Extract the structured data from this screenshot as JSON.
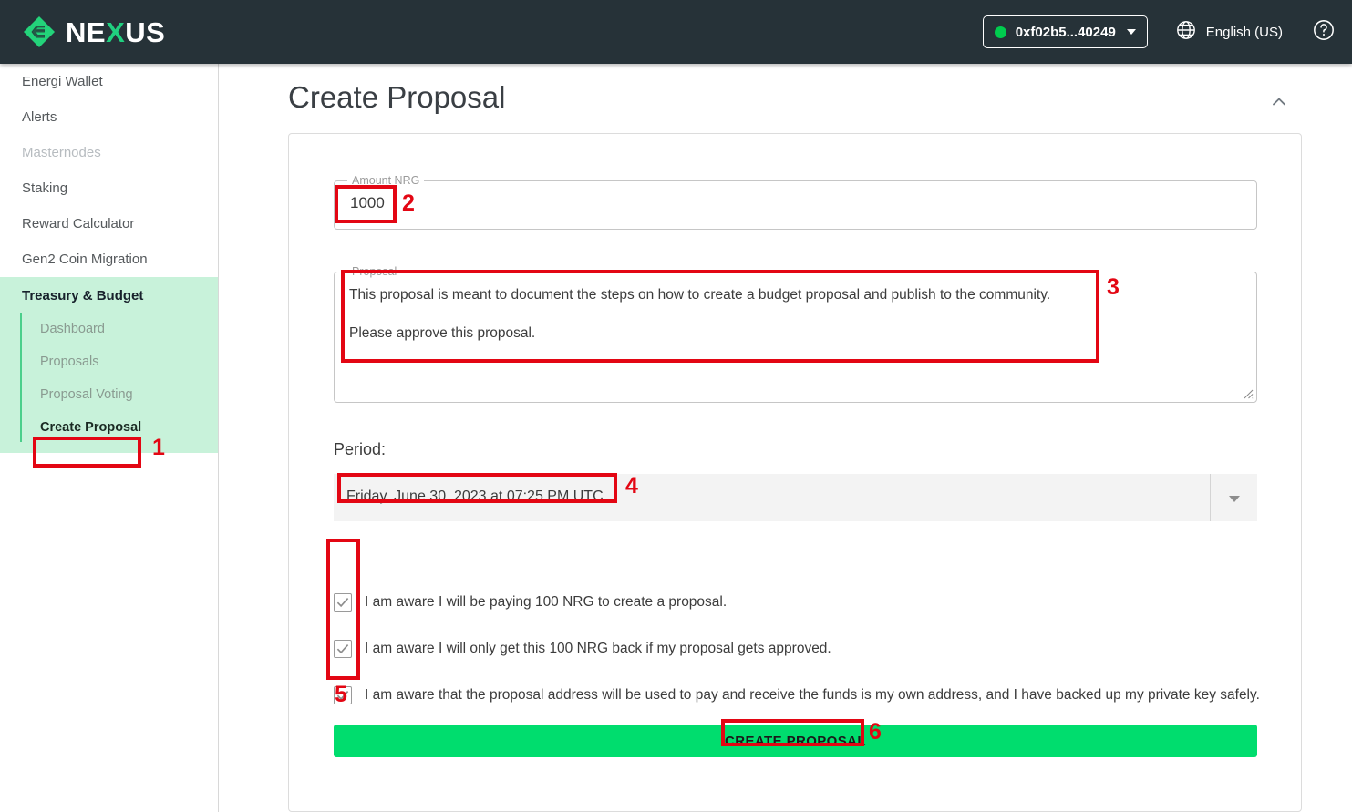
{
  "header": {
    "logo_text_1": "NE",
    "logo_text_x": "X",
    "logo_text_2": "US",
    "logo_icon": "nexus-diamond-logo",
    "wallet_address": "0xf02b5...40249",
    "wallet_caret_icon": "chevron-down-icon",
    "status_dot_icon": "status-online-dot",
    "globe_icon": "globe-icon",
    "language": "English (US)",
    "help_icon": "help-circle-icon",
    "background_color": "#263238",
    "status_color": "#00cc4e",
    "accent_color": "#20d07f"
  },
  "sidebar": {
    "items": [
      {
        "label": "Energi Wallet",
        "state": "normal"
      },
      {
        "label": "Alerts",
        "state": "normal"
      },
      {
        "label": "Masternodes",
        "state": "disabled"
      },
      {
        "label": "Staking",
        "state": "normal"
      },
      {
        "label": "Reward Calculator",
        "state": "normal"
      },
      {
        "label": "Gen2 Coin Migration",
        "state": "normal"
      }
    ],
    "group": {
      "title": "Treasury & Budget",
      "background_color": "#c8f2da",
      "rail_color": "#4bcf8b",
      "sub_items": [
        {
          "label": "Dashboard",
          "active": false
        },
        {
          "label": "Proposals",
          "active": false
        },
        {
          "label": "Proposal Voting",
          "active": false
        },
        {
          "label": "Create Proposal",
          "active": true
        }
      ]
    }
  },
  "main": {
    "page_title": "Create Proposal",
    "collapse_icon": "chevron-up-icon",
    "amount": {
      "label": "Amount NRG",
      "value": "1000"
    },
    "proposal": {
      "label": "Proposal",
      "value": "This proposal is meant to document the steps on how to create a budget proposal and publish to the community.\n\nPlease approve this proposal.",
      "resize_icon": "resize-handle-icon"
    },
    "period": {
      "label": "Period:",
      "value": "Friday, June 30, 2023 at 07:25 PM UTC",
      "caret_icon": "dropdown-caret-icon"
    },
    "checkboxes": [
      {
        "label": "I am aware I will be paying 100 NRG to create a proposal.",
        "checked": true
      },
      {
        "label": "I am aware I will only get this 100 NRG back if my proposal gets approved.",
        "checked": true
      },
      {
        "label": "I am aware that the proposal address will be used to pay and receive the funds is my own address, and I have backed up my private key safely.",
        "checked": true
      }
    ],
    "submit_button": {
      "label": "CREATE PROPOSAL",
      "color": "#00dd6e"
    }
  },
  "annotations": {
    "color": "#e30613",
    "steps": [
      {
        "number": "1",
        "target": "sidebar-create-proposal"
      },
      {
        "number": "2",
        "target": "amount-input-value"
      },
      {
        "number": "3",
        "target": "proposal-textarea-text"
      },
      {
        "number": "4",
        "target": "period-value"
      },
      {
        "number": "5",
        "target": "checkbox-column"
      },
      {
        "number": "6",
        "target": "create-proposal-button"
      }
    ]
  }
}
